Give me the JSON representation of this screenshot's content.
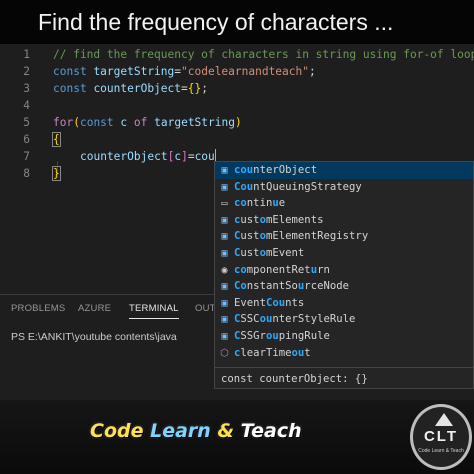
{
  "title": "Find the frequency of characters ...",
  "editor": {
    "lines": [
      {
        "n": "1",
        "comment": "// find the frequency of characters in string using for-of loop"
      },
      {
        "n": "2",
        "kw": "const",
        "var": "targetString",
        "op": "=",
        "str": "\"codelearnandteach\"",
        "end": ";"
      },
      {
        "n": "3",
        "kw": "const",
        "var": "counterObject",
        "op": "=",
        "braces": "{}",
        "end": ";"
      },
      {
        "n": "4"
      },
      {
        "n": "5",
        "for": "for",
        "open": "(",
        "kw": "const",
        "c": "c",
        "of": "of",
        "var": "targetString",
        "close": ")"
      },
      {
        "n": "6",
        "brace": "{"
      },
      {
        "n": "7",
        "var": "counterObject",
        "idx_open": "[",
        "idx": "c",
        "idx_close": "]",
        "op": "=",
        "typed": "cou"
      },
      {
        "n": "8",
        "brace": "}"
      }
    ]
  },
  "suggestions": {
    "items": [
      {
        "label": "counterObject",
        "icon": "variable-icon",
        "selected": true
      },
      {
        "label": "CountQueuingStrategy",
        "icon": "variable-icon"
      },
      {
        "label": "continue",
        "icon": "keyword-icon"
      },
      {
        "label": "customElements",
        "icon": "variable-icon"
      },
      {
        "label": "CustomElementRegistry",
        "icon": "variable-icon"
      },
      {
        "label": "CustomEvent",
        "icon": "variable-icon"
      },
      {
        "label": "componentReturn",
        "icon": "property-icon"
      },
      {
        "label": "ConstantSourceNode",
        "icon": "variable-icon"
      },
      {
        "label": "EventCounts",
        "icon": "variable-icon"
      },
      {
        "label": "CSSCounterStyleRule",
        "icon": "variable-icon"
      },
      {
        "label": "CSSGroupingRule",
        "icon": "variable-icon"
      },
      {
        "label": "clearTimeout",
        "icon": "function-icon"
      }
    ],
    "detail": "const counterObject: {}"
  },
  "panel": {
    "tabs": [
      "PROBLEMS",
      "AZURE",
      "TERMINAL",
      "OUT"
    ],
    "active_tab": "TERMINAL",
    "terminal_text": "PS E:\\ANKIT\\youtube contents\\java"
  },
  "footer": {
    "brand": "Code Learn & Teach",
    "brand_parts": [
      "Code",
      "Learn",
      "&",
      "Teach"
    ],
    "logo_text": "CLT",
    "logo_sub": "Code Learn & Teach"
  },
  "colors": {
    "editor_bg": "#1e1e1e",
    "keyword": "#569cd6",
    "control": "#c586c0",
    "variable": "#9cdcfe",
    "string": "#ce9178",
    "comment": "#6a9955",
    "match_highlight": "#2aaaff",
    "selected_item": "#04395e"
  }
}
